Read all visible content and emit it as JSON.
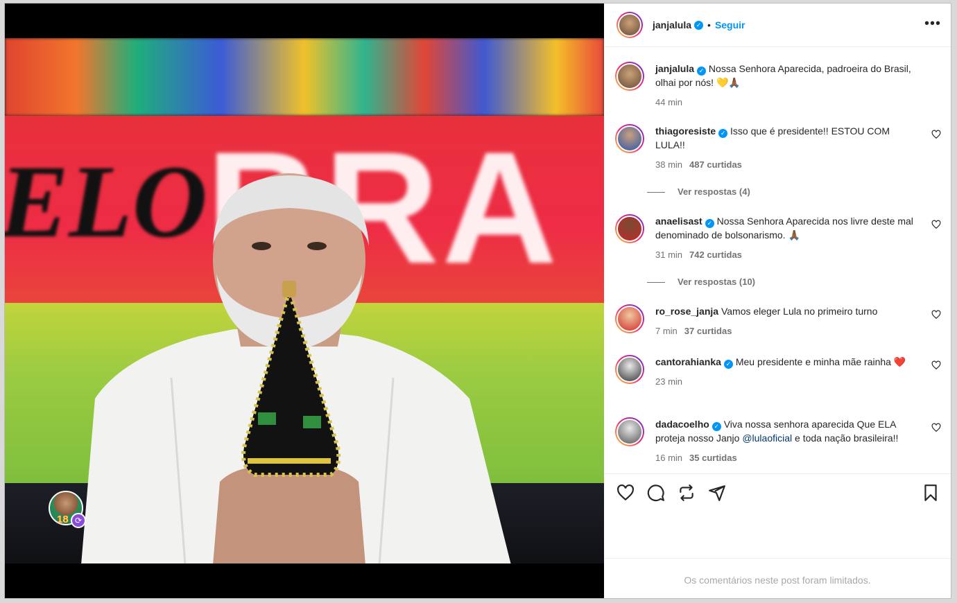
{
  "post": {
    "author": "janjalula",
    "follow_label": "Seguir",
    "separator": "•",
    "more_label": "•••",
    "caption": "Nossa Senhora Aparecida, padroeira do Brasil, olhai por nós! 💛🙏🏾",
    "caption_time": "44 min",
    "overlay_badge_number": "18"
  },
  "media": {
    "banner_left": "ELO",
    "banner_right": "BRA"
  },
  "comments": [
    {
      "user": "thiagoresiste",
      "verified": true,
      "text": "Isso que é presidente!! ESTOU COM LULA!!",
      "time": "38 min",
      "likes": "487 curtidas",
      "replies": "Ver respostas (4)"
    },
    {
      "user": "anaelisast",
      "verified": true,
      "text": "Nossa Senhora Aparecida nos livre deste mal denominado de bolsonarismo. 🙏🏾",
      "time": "31 min",
      "likes": "742 curtidas",
      "replies": "Ver respostas (10)"
    },
    {
      "user": "ro_rose_janja",
      "verified": false,
      "text": "Vamos eleger Lula no primeiro turno",
      "time": "7 min",
      "likes": "37 curtidas"
    },
    {
      "user": "cantorahianka",
      "verified": true,
      "text": "Meu presidente e minha mãe rainha ❤️",
      "time": "23 min"
    },
    {
      "user": "dadacoelho",
      "verified": true,
      "text_before": "Viva nossa senhora aparecida Que ELA proteja nosso Janjo ",
      "mention": "@lulaoficial",
      "text_after": " e toda nação brasileira!!",
      "time": "16 min",
      "likes": "35 curtidas"
    }
  ],
  "footer": {
    "limited_text": "Os comentários neste post foram limitados."
  },
  "icons": [
    "heart-icon",
    "comment-icon",
    "repost-icon",
    "share-icon",
    "bookmark-icon",
    "verified-icon",
    "more-icon"
  ],
  "colors": {
    "accent": "#0095f6",
    "text": "#262626",
    "muted": "#737373",
    "link": "#00376b"
  }
}
